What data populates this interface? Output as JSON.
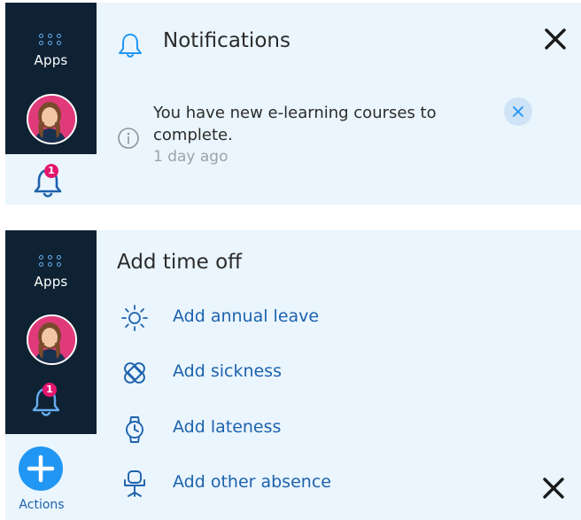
{
  "colors": {
    "panel_bg": "#eaf5fd",
    "rail_bg": "#0e2233",
    "accent_blue": "#2196f3",
    "link_blue": "#1d62ad",
    "badge_pink": "#e3176e"
  },
  "notifications_panel": {
    "rail": {
      "apps_label": "Apps",
      "bell_badge": "1"
    },
    "title": "Notifications",
    "items": [
      {
        "message": "You have new e-learning courses to complete.",
        "time": "1 day ago",
        "icon": "info-icon"
      }
    ],
    "close_icon": "close-icon"
  },
  "time_off_panel": {
    "rail": {
      "apps_label": "Apps",
      "bell_badge": "1",
      "actions_label": "Actions"
    },
    "title": "Add time off",
    "menu": [
      {
        "label": "Add annual leave",
        "icon": "sun-icon"
      },
      {
        "label": "Add sickness",
        "icon": "plaster-icon"
      },
      {
        "label": "Add lateness",
        "icon": "watch-icon"
      },
      {
        "label": "Add other absence",
        "icon": "chair-icon"
      }
    ],
    "close_icon": "close-icon"
  }
}
